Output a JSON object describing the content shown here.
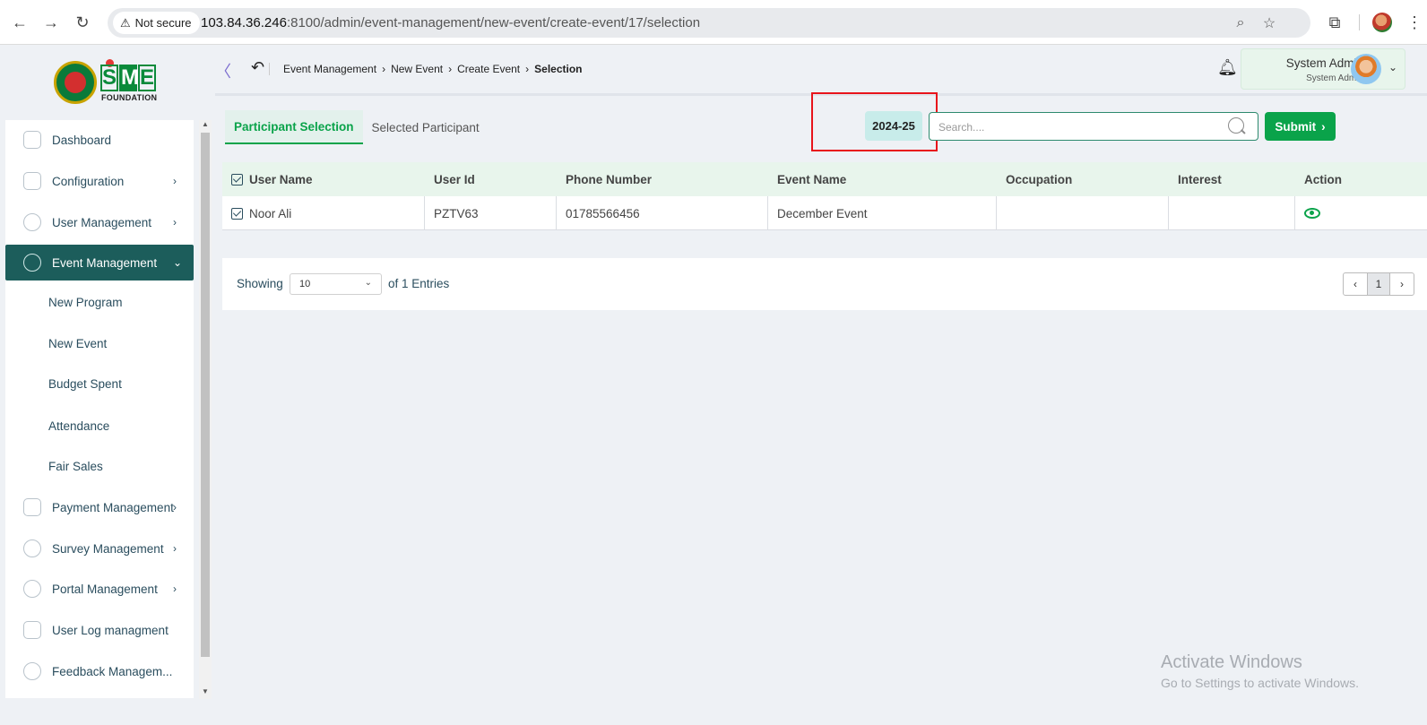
{
  "browser": {
    "security_label": "Not secure",
    "url_host": "103.84.36.246",
    "url_rest": ":8100/admin/event-management/new-event/create-event/17/selection"
  },
  "logo": {
    "letters": [
      "S",
      "M",
      "E"
    ],
    "subtitle": "FOUNDATION"
  },
  "sidebar": {
    "items": [
      {
        "label": "Dashboard",
        "icon": "grid-icon"
      },
      {
        "label": "Configuration",
        "icon": "config-icon",
        "chevron": "›"
      },
      {
        "label": "User Management",
        "icon": "shield-icon",
        "chevron": "›"
      },
      {
        "label": "Event Management",
        "icon": "event-icon",
        "chevron": "⌄",
        "active": true
      },
      {
        "label": "New Program"
      },
      {
        "label": "New Event"
      },
      {
        "label": "Budget Spent"
      },
      {
        "label": "Attendance"
      },
      {
        "label": "Fair Sales"
      },
      {
        "label": "Payment Management",
        "icon": "payment-icon",
        "chevron": "›"
      },
      {
        "label": "Survey Management",
        "icon": "pie-icon",
        "chevron": "›"
      },
      {
        "label": "Portal Management",
        "icon": "portal-icon",
        "chevron": "›"
      },
      {
        "label": "User Log managment",
        "icon": "log-icon"
      },
      {
        "label": "Feedback Managem...",
        "icon": "feedback-icon"
      }
    ]
  },
  "header": {
    "breadcrumb": [
      "Event Management",
      "New Event",
      "Create Event",
      "Selection"
    ],
    "user_name": "System Admin",
    "user_role": "System Admin"
  },
  "toolbar": {
    "tabs": [
      {
        "label": "Participant Selection",
        "active": true
      },
      {
        "label": "Selected Participant",
        "active": false
      }
    ],
    "year": "2024-25",
    "search_placeholder": "Search....",
    "submit_label": "Submit"
  },
  "table": {
    "columns": [
      "User Name",
      "User Id",
      "Phone Number",
      "Event Name",
      "Occupation",
      "Interest",
      "Action"
    ],
    "rows": [
      {
        "user_name": "Noor Ali",
        "user_id": "PZTV63",
        "phone": "01785566456",
        "event": "December Event",
        "occupation": "",
        "interest": ""
      }
    ]
  },
  "pagination": {
    "showing_label": "Showing",
    "per_page": "10",
    "entries_label": "of 1 Entries",
    "current_page": "1"
  },
  "watermark": {
    "title": "Activate Windows",
    "subtitle": "Go to Settings to activate Windows."
  },
  "colors": {
    "accent_green": "#0aa34a",
    "active_nav": "#1c5d5b",
    "highlight_red": "#e8141b"
  }
}
